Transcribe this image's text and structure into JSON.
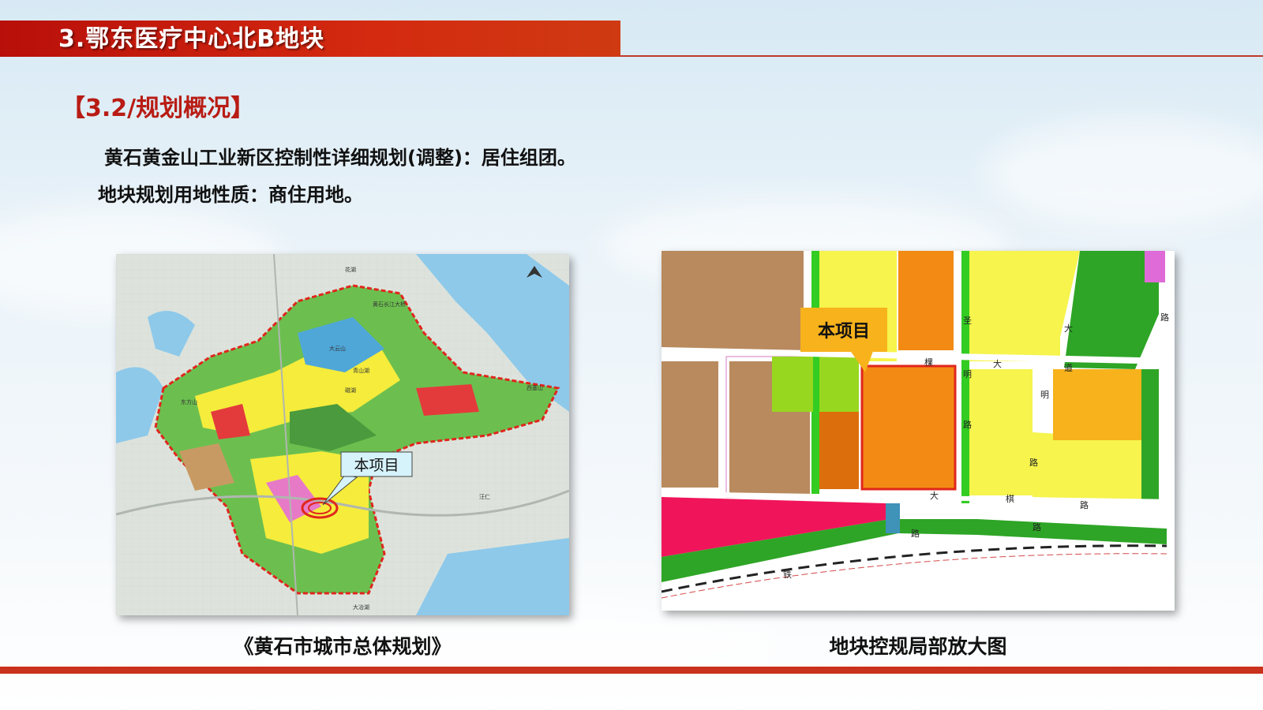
{
  "header": {
    "title": "3.鄂东医疗中心北B地块"
  },
  "section": {
    "title": "【3.2/规划概况】"
  },
  "body": {
    "line1": "黄石黄金山工业新区控制性详细规划(调整)：居住组团。",
    "line2": "地块规划用地性质：商住用地。"
  },
  "left_map": {
    "callout": "本项目",
    "caption": "《黄石市城市总体规划》",
    "labels": [
      "花湖",
      "黄石长江大桥",
      "大冶湖",
      "东方山",
      "磁湖",
      "青山湖",
      "汪仁",
      "大云山",
      "西塞山"
    ]
  },
  "right_map": {
    "callout": "本项目",
    "caption": "地块控规局部放大图",
    "road_chars": [
      "圣",
      "棵",
      "明",
      "路",
      "大",
      "道",
      "明",
      "路",
      "大",
      "棋",
      "路",
      "大",
      "路",
      "铁",
      "路",
      "路"
    ]
  },
  "colors": {
    "accent": "#c9321c",
    "title_red": "#b81c14"
  }
}
